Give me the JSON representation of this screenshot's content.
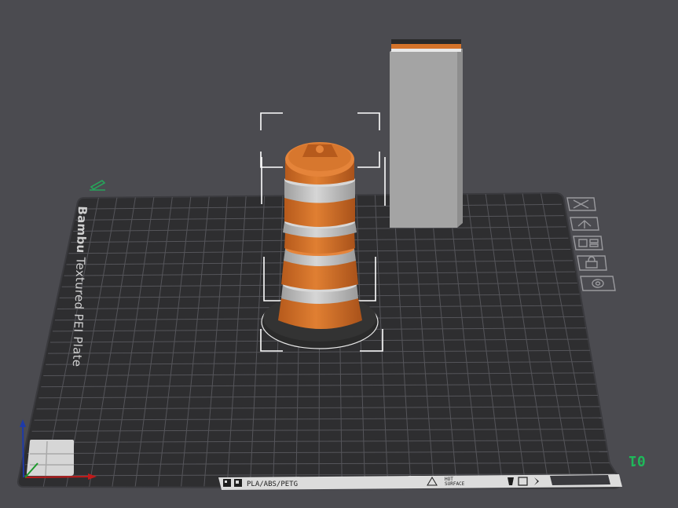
{
  "plate": {
    "brand": "Bambu",
    "type": "Textured PEI Plate",
    "number": "01"
  },
  "bottom_strip": {
    "filaments": "PLA/ABS/PETG",
    "warning_line1": "HOT",
    "warning_line2": "SURFACE"
  },
  "side_icons": [
    "close-icon",
    "auto-orient-icon",
    "arrange-icon",
    "lock-icon",
    "settings-icon"
  ],
  "colors": {
    "background": "#4b4b50",
    "plate": "#2e2e30",
    "grid": "#5a5a5e",
    "cone_orange": "#d4732a",
    "cone_white": "#c8c8c8",
    "cone_base": "#2a2a2a",
    "wipe_tower": "#a4a4a4",
    "plate_number": "#1fb85a"
  }
}
